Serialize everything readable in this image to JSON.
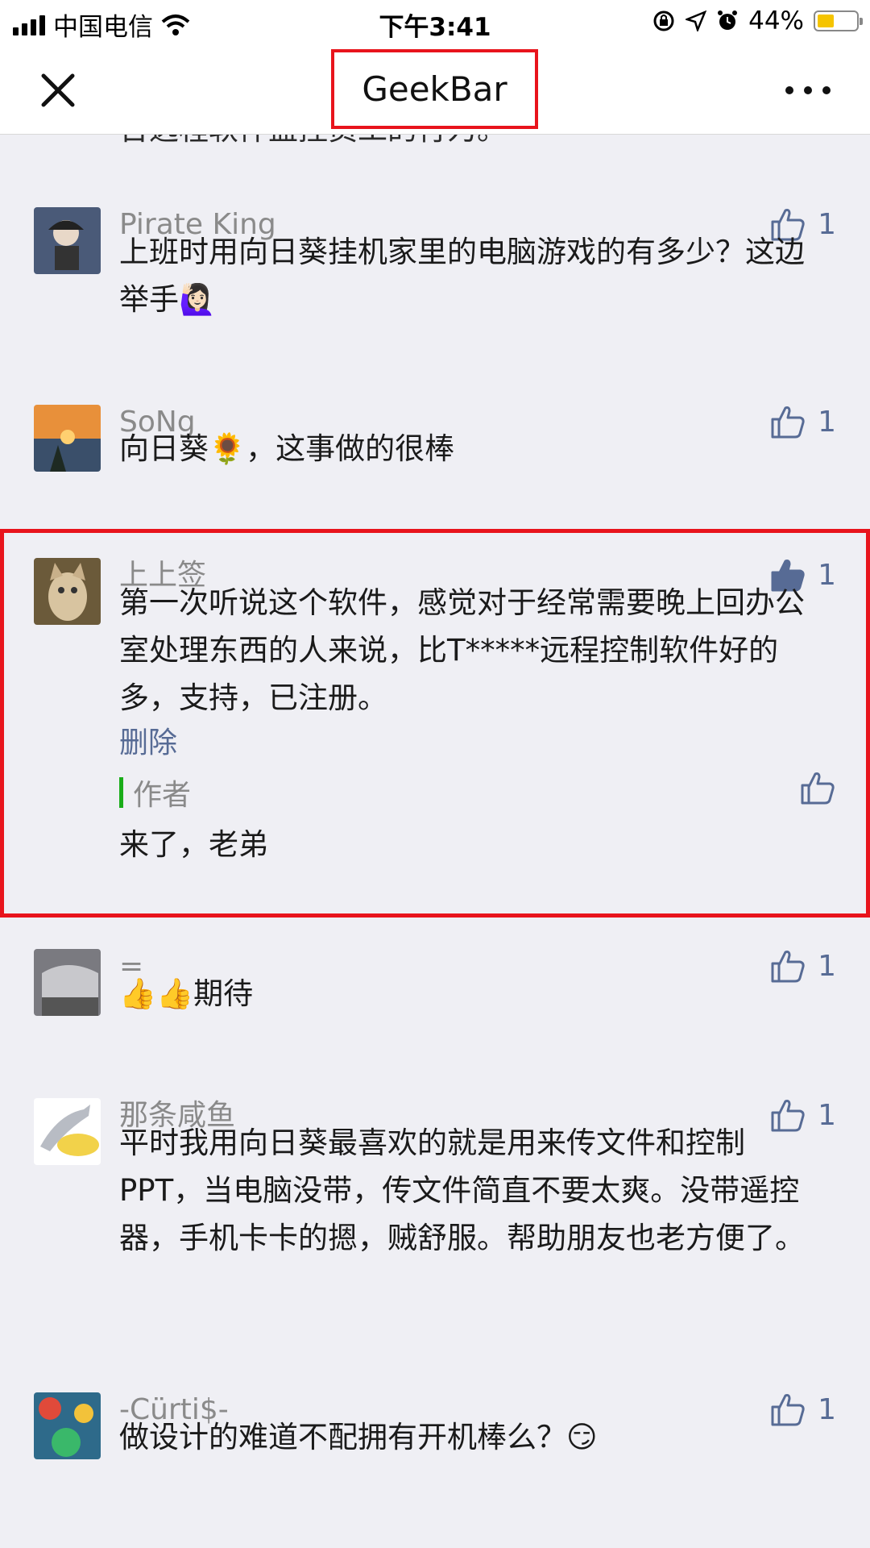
{
  "status": {
    "carrier": "中国电信",
    "time": "下午3:41",
    "battery": "44%",
    "battery_level": 0.44
  },
  "nav": {
    "title": "GeekBar",
    "close_icon": "close-icon",
    "more_icon": "more-icon"
  },
  "clipped_line": "台远程软件监控员工的行为。",
  "comments": [
    {
      "name": "Pirate King",
      "body": "上班时用向日葵挂机家里的电脑游戏的有多少？这边举手🙋🏻‍♀️",
      "likes": "1",
      "liked": false
    },
    {
      "name": "SoNg",
      "body": "向日葵🌻，这事做的很棒",
      "likes": "1",
      "liked": false
    },
    {
      "name": "上上签",
      "body": "第一次听说这个软件，感觉对于经常需要晚上回办公室处理东西的人来说，比T*****远程控制软件好的多，支持，已注册。",
      "likes": "1",
      "liked": true,
      "delete": "删除",
      "reply_author": "作者",
      "reply_text": "来了，老弟"
    },
    {
      "name": "=",
      "body": "👍👍期待",
      "likes": "1",
      "liked": false
    },
    {
      "name": "那条咸鱼",
      "body": "平时我用向日葵最喜欢的就是用来传文件和控制PPT，当电脑没带，传文件简直不要太爽。没带遥控器，手机卡卡的摁，贼舒服。帮助朋友也老方便了。",
      "likes": "1",
      "liked": false
    },
    {
      "name": "-Cürti$-",
      "body": "做设计的难道不配拥有开机棒么？😏",
      "likes": "1",
      "liked": false
    }
  ],
  "colors": {
    "accent": "#576b95",
    "highlight": "#e8141c",
    "author_bar": "#1aad19",
    "background": "#efeff4"
  }
}
